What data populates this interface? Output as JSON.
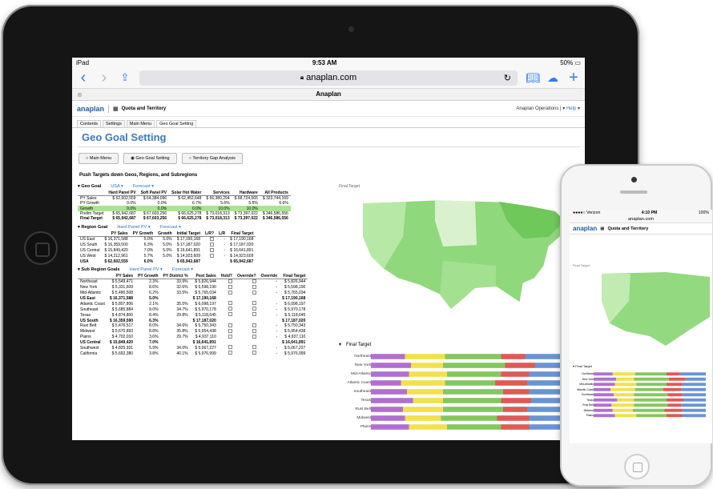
{
  "ipad": {
    "status": {
      "carrier": "iPad",
      "time": "9:53 AM",
      "battery": "50%"
    },
    "url": "anaplan.com",
    "tab_title": "Anaplan",
    "app": {
      "logo": "anaplan",
      "model_title": "Quota and Territory",
      "user_menu": "Anaplan Operations",
      "help": "Help"
    },
    "app_tabs": [
      "Contents",
      "Settings",
      "Main Menu",
      "Geo Goal Setting"
    ],
    "page_title": "Geo Goal Setting",
    "action_buttons": [
      "Main Menu",
      "Geo Goal Setting",
      "Territory Gap Analysis"
    ],
    "push_label": "Push Targets down Geos, Regions, and Subregions",
    "geo_goal": {
      "label": "Geo Goal",
      "dd1": "USA",
      "dd2": "Forecast",
      "headers": [
        "",
        "Hard Panel PV",
        "Soft Panel PV",
        "Solar Hot Water",
        "Services",
        "Hardware",
        "All Products"
      ],
      "rows": [
        [
          "PY Sales",
          "$ 62,602,559",
          "$ 64,384,096",
          "$ 62,452,648",
          "$ 66,380,294",
          "$ 68,724,565",
          "$ 323,744,169"
        ],
        [
          "PY Growth",
          "0.0%",
          "0.0%",
          "6.7%",
          "5.6%",
          "5.5%",
          "6.6%"
        ],
        [
          "Growth",
          "0.0%",
          "0.0%",
          "0.0%",
          "10.0%",
          "10.0%",
          ""
        ],
        [
          "Prelim Target",
          "$ 65,942,687",
          "$ 67,603,256",
          "$ 66,625,278",
          "$ 73,018,313",
          "$ 73,397,022",
          "$ 346,586,556"
        ],
        [
          "Final Target",
          "$ 65,942,687",
          "$ 67,603,256",
          "$ 66,625,278",
          "$ 73,018,313",
          "$ 73,397,022",
          "$ 346,586,556"
        ]
      ]
    },
    "region_goal": {
      "label": "Region Goal",
      "dd1": "Hard Panel PV",
      "dd2": "Forecast",
      "headers": [
        "",
        "PY Sales",
        "PY Growth",
        "Growth",
        "Initial Target",
        "L/R?",
        "L/R",
        "Final Target"
      ],
      "rows": [
        [
          "US East",
          "$ 16,371,588",
          "5.0%",
          "5.0%",
          "$ 17,190,168",
          "",
          "-",
          "$ 17,190,168"
        ],
        [
          "US South",
          "$ 16,359,500",
          "6.3%",
          "5.0%",
          "$ 17,187,020",
          "",
          "-",
          "$ 17,187,020"
        ],
        [
          "US Central",
          "$ 15,849,420",
          "7.0%",
          "5.0%",
          "$ 16,641,891",
          "",
          "-",
          "$ 16,641,891"
        ],
        [
          "US West",
          "$ 14,212,961",
          "5.7%",
          "5.0%",
          "$ 14,923,609",
          "",
          "-",
          "$ 14,923,609"
        ],
        [
          "USA",
          "$ 62,602,559",
          "6.0%",
          "",
          "$ 65,942,687",
          "",
          "",
          "$ 65,942,687"
        ]
      ]
    },
    "subregion_goals": {
      "label": "Sub Region Goals",
      "dd1": "Hard Panel PV",
      "dd2": "Forecast",
      "headers": [
        "",
        "PY Sales",
        "PY Growth",
        "PY District %",
        "Post Sales",
        "Hold?",
        "Override?",
        "Override",
        "Final Target"
      ],
      "rows": [
        [
          "Northeast",
          "$ 5,549,471",
          "2.3%",
          "33.9%",
          "$ 5,826,944",
          "",
          "",
          "-",
          "$ 5,826,944"
        ],
        [
          "New York",
          "$ 5,331,609",
          "8.6%",
          "32.6%",
          "$ 5,598,190",
          "",
          "",
          "-",
          "$ 5,598,190"
        ],
        [
          "Mid-Atlantic",
          "$ 5,490,508",
          "6.2%",
          "33.5%",
          "$ 5,765,034",
          "",
          "",
          "-",
          "$ 5,765,034"
        ],
        [
          "US East",
          "$ 16,371,588",
          "5.0%",
          "",
          "$ 17,190,168",
          "",
          "",
          "",
          "$ 17,190,168"
        ],
        [
          "Atlantic Coast",
          "$ 5,807,806",
          "2.1%",
          "35.5%",
          "$ 6,098,197",
          "",
          "",
          "-",
          "$ 6,098,197"
        ],
        [
          "Southeast",
          "$ 5,685,884",
          "9.0%",
          "34.7%",
          "$ 5,970,178",
          "",
          "",
          "-",
          "$ 5,970,178"
        ],
        [
          "Texas",
          "$ 4,874,800",
          "8.4%",
          "29.8%",
          "$ 5,118,645",
          "",
          "",
          "-",
          "$ 5,118,645"
        ],
        [
          "US South",
          "$ 16,359,590",
          "6.3%",
          "",
          "$ 17,187,020",
          "",
          "",
          "",
          "$ 17,187,020"
        ],
        [
          "Rust Belt",
          "$ 5,476,517",
          "8.0%",
          "34.6%",
          "$ 5,750,343",
          "",
          "",
          "-",
          "$ 5,750,343"
        ],
        [
          "Midwest",
          "$ 5,670,893",
          "8.8%",
          "35.8%",
          "$ 5,954,438",
          "",
          "",
          "-",
          "$ 5,954,438"
        ],
        [
          "Plains",
          "$ 4,702,010",
          "3.6%",
          "29.7%",
          "$ 4,937,110",
          "",
          "",
          "-",
          "$ 4,937,110"
        ],
        [
          "US Central",
          "$ 15,849,420",
          "7.0%",
          "",
          "$ 16,641,891",
          "",
          "",
          "",
          "$ 16,641,891"
        ],
        [
          "Southwest",
          "$ 4,825,931",
          "5.9%",
          "34.0%",
          "$ 5,067,227",
          "",
          "",
          "-",
          "$ 5,067,227"
        ],
        [
          "California",
          "$ 5,692,380",
          "3.8%",
          "40.1%",
          "$ 5,976,999",
          "",
          "",
          "-",
          "$ 5,976,999"
        ]
      ]
    },
    "map_caption": "Final Target",
    "bar_chart_title": "Final Target",
    "bar_chart": {
      "type": "bar",
      "categories": [
        "Northeast",
        "New York",
        "Mid-Atlantic",
        "Atlantic Coast",
        "Southeast",
        "Texas",
        "Rust Belt",
        "Midwest",
        "Plains"
      ],
      "series_colors": [
        "#b06fd0",
        "#f2e04c",
        "#84c75e",
        "#de5a55",
        "#6a93d6"
      ],
      "rows": [
        [
          0.17,
          0.2,
          0.28,
          0.12,
          0.23
        ],
        [
          0.2,
          0.16,
          0.31,
          0.15,
          0.18
        ],
        [
          0.19,
          0.19,
          0.27,
          0.14,
          0.21
        ],
        [
          0.15,
          0.22,
          0.25,
          0.16,
          0.22
        ],
        [
          0.18,
          0.18,
          0.3,
          0.13,
          0.21
        ],
        [
          0.21,
          0.15,
          0.29,
          0.15,
          0.2
        ],
        [
          0.16,
          0.2,
          0.3,
          0.12,
          0.22
        ],
        [
          0.17,
          0.18,
          0.28,
          0.16,
          0.21
        ],
        [
          0.19,
          0.19,
          0.27,
          0.14,
          0.21
        ]
      ]
    }
  },
  "iphone": {
    "status": {
      "carrier": "Verizon",
      "time": "4:10 PM",
      "battery": "100%"
    },
    "url": "anaplan.com",
    "logo": "anaplan",
    "model_title": "Quota and Territory",
    "map_caption": "Final Target",
    "bar_caption": "Final Target",
    "bar_labels": [
      "Northeast",
      "New York",
      "Mid-Atlantic",
      "Atlantic Coast",
      "Southeast",
      "Texas",
      "Rust Belt",
      "Midwest",
      "Plains"
    ]
  }
}
